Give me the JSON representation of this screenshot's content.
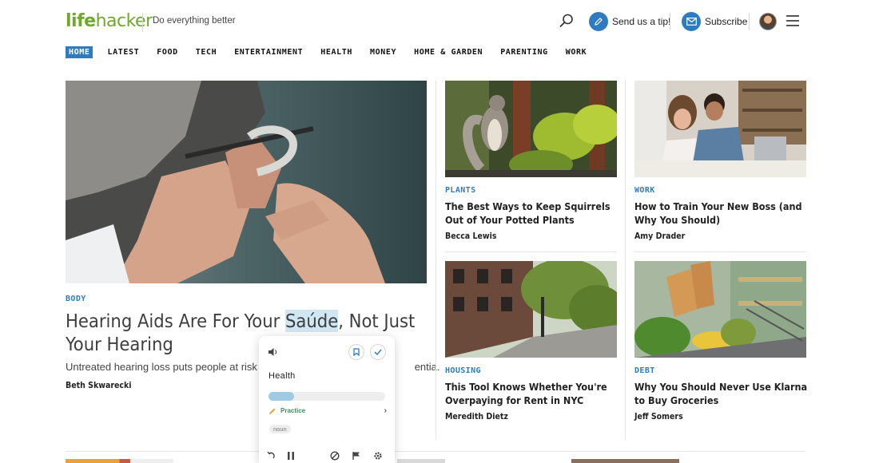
{
  "header": {
    "logo_part1": "life",
    "logo_part2": "hacker",
    "tagline": "Do everything better",
    "tip_label": "Send us a tip!",
    "subscribe_label": "Subscribe"
  },
  "nav": {
    "items": [
      "HOME",
      "LATEST",
      "FOOD",
      "TECH",
      "ENTERTAINMENT",
      "HEALTH",
      "MONEY",
      "HOME & GARDEN",
      "PARENTING",
      "WORK"
    ],
    "active": "HOME"
  },
  "hero": {
    "kicker": "BODY",
    "title_before": "Hearing Aids Are For Your ",
    "title_highlight": "Saúde",
    "title_after": ", Not Just Your Hearing",
    "subtitle_left": "Untreated hearing loss puts people at risk for",
    "subtitle_right": "entia.",
    "author": "Beth Skwarecki"
  },
  "cards": [
    {
      "kicker": "PLANTS",
      "title": "The Best Ways to Keep Squirrels Out of Your Potted Plants",
      "author": "Becca Lewis"
    },
    {
      "kicker": "WORK",
      "title": "How to Train Your New Boss (and Why You Should)",
      "author": "Amy Drader"
    },
    {
      "kicker": "HOUSING",
      "title": "This Tool Knows Whether You're Overpaying for Rent in NYC",
      "author": "Meredith Dietz"
    },
    {
      "kicker": "DEBT",
      "title": "Why You Should Never Use Klarna to Buy Groceries",
      "author": "Jeff Somers"
    }
  ],
  "popup": {
    "word": "Health",
    "progress": 0.22,
    "practice_label": "Practice",
    "part_of_speech": "noun"
  },
  "colors": {
    "brand_green": "#6fa82a",
    "accent_blue": "#2f7bbf",
    "highlight": "#cfe6f3"
  }
}
